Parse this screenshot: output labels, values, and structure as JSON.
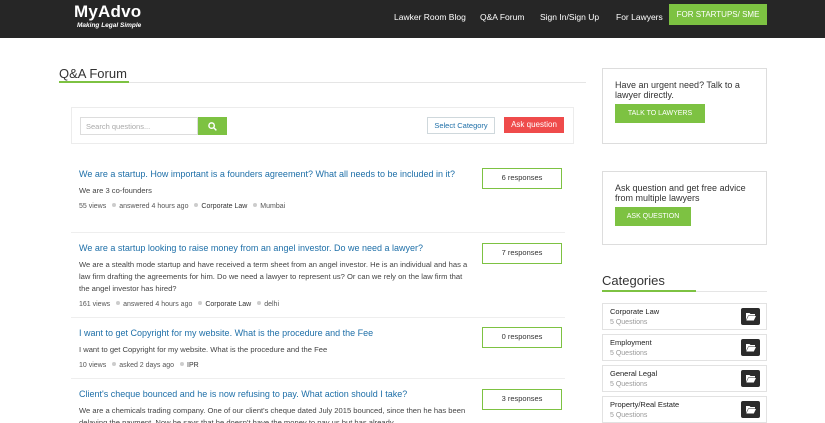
{
  "header": {
    "logo": "MyAdvo",
    "tagline": "Making Legal Simple",
    "nav": [
      "Lawker Room Blog",
      "Q&A Forum",
      "Sign In/Sign Up",
      "For Lawyers"
    ],
    "cta": "FOR STARTUPS/ SME",
    "accent_color": "#7dc242"
  },
  "page": {
    "title": "Q&A Forum"
  },
  "search": {
    "placeholder": "Search questions...",
    "button_icon": "search-icon",
    "select_category": "Select Category",
    "ask_button": "Ask question"
  },
  "questions": [
    {
      "title": "We are a startup. How important is a founders agreement? What all needs to be included in it?",
      "body": "We are 3 co-founders",
      "views": "55 views",
      "time": "answered 4 hours ago",
      "category": "Corporate Law",
      "location": "Mumbai",
      "responses": "6 responses"
    },
    {
      "title": "We are a startup looking to raise money from an angel investor. Do we need a lawyer?",
      "body": "We are a stealth mode startup and have received a term sheet from an angel investor. He is an individual and has a law firm drafting the agreements for him. Do we need a lawyer to represent us? Or can we rely on the law firm that the angel investor has hired?",
      "views": "161 views",
      "time": "answered 4 hours ago",
      "category": "Corporate Law",
      "location": "delhi",
      "responses": "7 responses"
    },
    {
      "title": "I want to get Copyright for my website. What is the procedure and the Fee",
      "body": "I want to get Copyright for my website. What is the procedure and the Fee",
      "views": "10 views",
      "time": "asked 2 days ago",
      "category": "IPR",
      "location": "",
      "responses": "0 responses"
    },
    {
      "title": "Client's cheque bounced and he is now refusing to pay. What action should I take?",
      "body": "We are a chemicals trading company. One of our client's cheque dated July 2015 bounced, since then he has been delaying the payment. Now he says that he doesn't have the money to pay us but has already",
      "views": "",
      "time": "",
      "category": "",
      "location": "",
      "responses": "3 responses"
    }
  ],
  "sidebar": {
    "talk_text": "Have an urgent need? Talk to a lawyer directly.",
    "talk_button": "TALK TO LAWYERS",
    "ask_text": "Ask question and get free advice from multiple lawyers",
    "ask_button": "ASK QUESTION",
    "categories_title": "Categories",
    "categories": [
      {
        "name": "Corporate Law",
        "count": "5 Questions",
        "icon": "folder-open-icon"
      },
      {
        "name": "Employment",
        "count": "5 Questions",
        "icon": "folder-open-icon"
      },
      {
        "name": "General Legal",
        "count": "5 Questions",
        "icon": "folder-open-icon"
      },
      {
        "name": "Property/Real Estate",
        "count": "5 Questions",
        "icon": "folder-open-icon"
      }
    ]
  }
}
